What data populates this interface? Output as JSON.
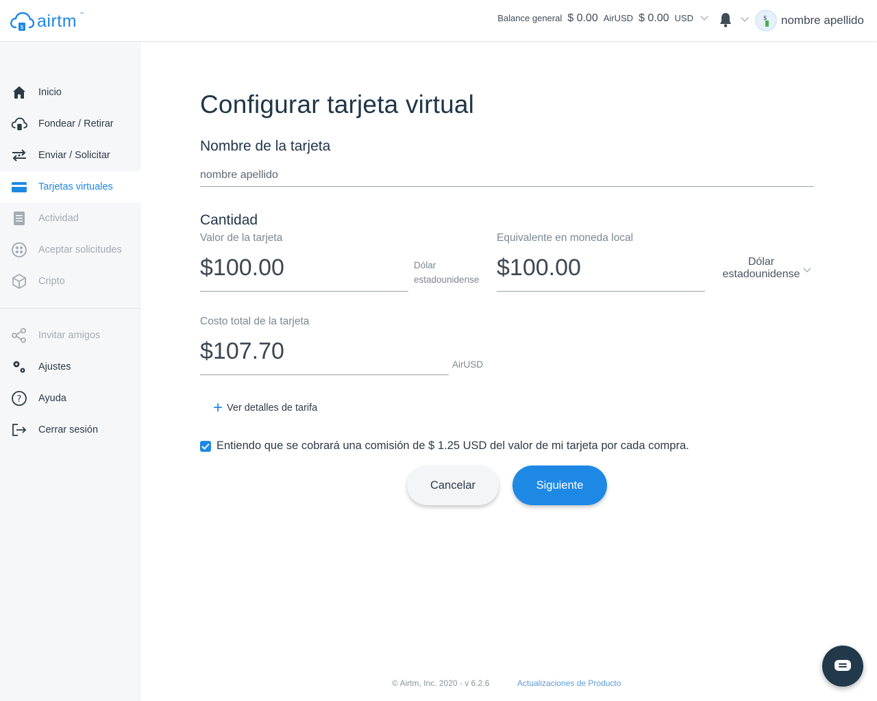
{
  "header": {
    "logo_text": "airtm",
    "logo_tm": "™",
    "balance_label": "Balance general",
    "balance_airusd_amount": "$ 0.00",
    "balance_airusd_unit": "AirUSD",
    "balance_usd_amount": "$ 0.00",
    "balance_usd_unit": "USD",
    "user_name": "nombre apellido"
  },
  "sidebar": {
    "items": [
      {
        "label": "Inicio",
        "icon": "home-icon"
      },
      {
        "label": "Fondear / Retirar",
        "icon": "cloud-money-icon"
      },
      {
        "label": "Enviar / Solicitar",
        "icon": "transfer-icon"
      },
      {
        "label": "Tarjetas virtuales",
        "icon": "card-icon"
      },
      {
        "label": "Actividad",
        "icon": "list-icon"
      },
      {
        "label": "Aceptar solicitudes",
        "icon": "requests-icon"
      },
      {
        "label": "Cripto",
        "icon": "cube-icon"
      },
      {
        "label": "Invitar amigos",
        "icon": "share-icon"
      },
      {
        "label": "Ajustes",
        "icon": "gears-icon"
      },
      {
        "label": "Ayuda",
        "icon": "help-icon"
      },
      {
        "label": "Cerrar sesión",
        "icon": "logout-icon"
      }
    ],
    "active_item": "Tarjetas virtuales"
  },
  "main": {
    "title": "Configurar tarjeta virtual",
    "card_name_title": "Nombre de la tarjeta",
    "card_name_value": "nombre apellido",
    "amount_title": "Cantidad",
    "card_value_label": "Valor de la tarjeta",
    "card_value": "$100.00",
    "card_value_unit_line1": "Dólar",
    "card_value_unit_line2": "estadounidense",
    "local_equiv_label": "Equivalente en moneda local",
    "local_value": "$100.00",
    "local_currency_line1": "Dólar",
    "local_currency_line2": "estadounidense",
    "total_cost_label": "Costo total de la tarjeta",
    "total_cost_value": "$107.70",
    "total_cost_unit": "AirUSD",
    "fee_details_link": "Ver detalles de tarifa",
    "consent_text": "Entiendo que se cobrará una comisión de $ 1.25 USD del valor de mi tarjeta por cada compra.",
    "consent_checked": true,
    "cancel_button": "Cancelar",
    "next_button": "Siguiente"
  },
  "footer": {
    "copyright": "© Airtm, Inc. 2020 - v 6.2.6",
    "updates_link": "Actualizaciones de Producto"
  },
  "colors": {
    "accent": "#1e88e5",
    "sidebar_bg": "#f6f7f9",
    "text_dark": "#1f3546",
    "text_muted": "#a3abb3",
    "chat_button": "#22384b"
  }
}
